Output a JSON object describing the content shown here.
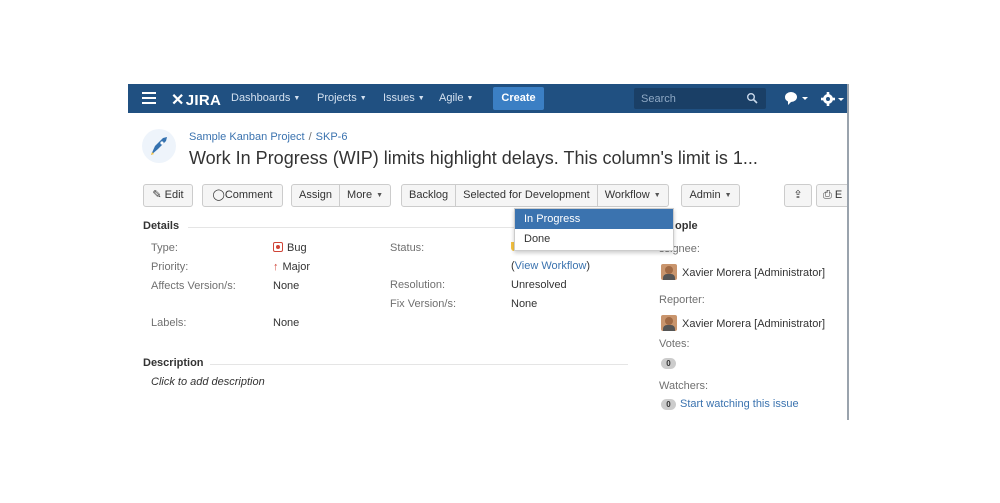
{
  "nav": {
    "logo": "JIRA",
    "items": [
      {
        "label": "Dashboards"
      },
      {
        "label": "Projects"
      },
      {
        "label": "Issues"
      },
      {
        "label": "Agile"
      }
    ],
    "create_label": "Create",
    "search_placeholder": "Search",
    "icons": [
      "menu-icon",
      "search-icon",
      "help-icon",
      "gear-icon"
    ]
  },
  "header": {
    "breadcrumb_project": "Sample Kanban Project",
    "breadcrumb_separator": "/",
    "breadcrumb_issue": "SKP-6",
    "title": "Work In Progress (WIP) limits highlight delays. This column's limit is 1..."
  },
  "toolbar": {
    "edit": "Edit",
    "comment": "Comment",
    "assign": "Assign",
    "more": "More",
    "backlog": "Backlog",
    "selected_for_development": "Selected for Development",
    "workflow": "Workflow",
    "admin": "Admin",
    "export_label": "E"
  },
  "workflow_menu": {
    "options": [
      "In Progress",
      "Done"
    ],
    "highlighted": "In Progress"
  },
  "details": {
    "heading": "Details",
    "type_label": "Type:",
    "type_value": "Bug",
    "priority_label": "Priority:",
    "priority_value": "Major",
    "affects_label": "Affects Version/s:",
    "affects_value": "None",
    "labels_label": "Labels:",
    "labels_value": "None",
    "status_label": "Status:",
    "view_workflow_open": "(",
    "view_workflow": "View Workflow",
    "view_workflow_close": ")",
    "resolution_label": "Resolution:",
    "resolution_value": "Unresolved",
    "fix_label": "Fix Version/s:",
    "fix_value": "None"
  },
  "description": {
    "heading": "Description",
    "placeholder": "Click to add description"
  },
  "people": {
    "heading": "ople",
    "assignee_label": "ssignee:",
    "assignee": "Xavier Morera [Administrator]",
    "reporter_label": "Reporter:",
    "reporter": "Xavier Morera [Administrator]",
    "votes_label": "Votes:",
    "votes_count": "0",
    "watchers_label": "Watchers:",
    "watchers_count": "0",
    "watch_link": "Start watching this issue"
  },
  "colors": {
    "nav_bg": "#205081",
    "create_btn": "#3b7fc4",
    "link": "#3b73af",
    "status_lozenge": "#f6c342",
    "menu_highlight": "#3b73af"
  }
}
